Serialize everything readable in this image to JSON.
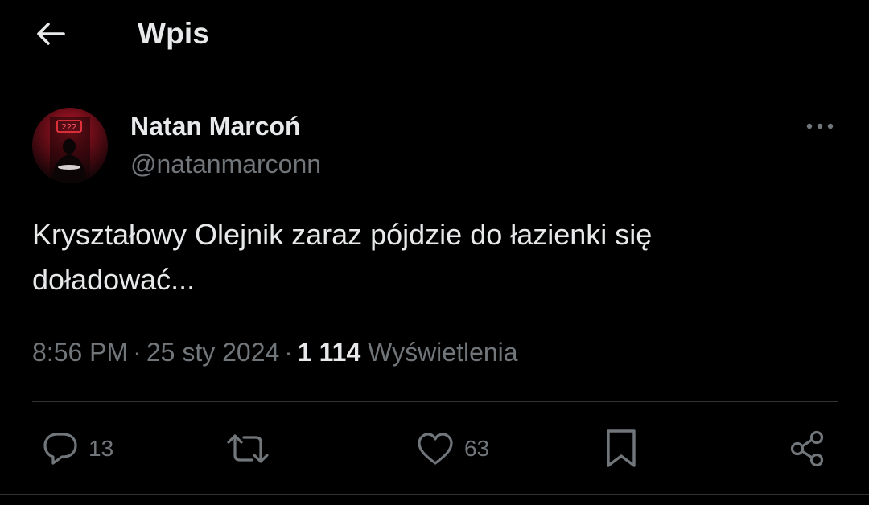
{
  "header": {
    "title": "Wpis",
    "back_icon": "arrow-left-icon"
  },
  "author": {
    "name": "Natan Marcoń",
    "handle": "@natanmarconn",
    "avatar_neon_text": "222"
  },
  "tweet": {
    "text": "Kryształowy Olejnik zaraz pójdzie do łazienki się\ndoładować...",
    "time": "8:56 PM",
    "date": "25 sty 2024",
    "views_count": "1 114",
    "views_label": "Wyświetlenia"
  },
  "actions": {
    "reply": {
      "icon": "reply-icon",
      "count": "13"
    },
    "retweet": {
      "icon": "retweet-icon",
      "count": ""
    },
    "like": {
      "icon": "heart-icon",
      "count": "63"
    },
    "bookmark": {
      "icon": "bookmark-icon",
      "count": ""
    },
    "share": {
      "icon": "share-icon",
      "count": ""
    }
  },
  "colors": {
    "background": "#000000",
    "text_primary": "#e7e9ea",
    "text_secondary": "#71767b",
    "divider": "#2f3336",
    "avatar_neon": "#ff2a3a"
  }
}
